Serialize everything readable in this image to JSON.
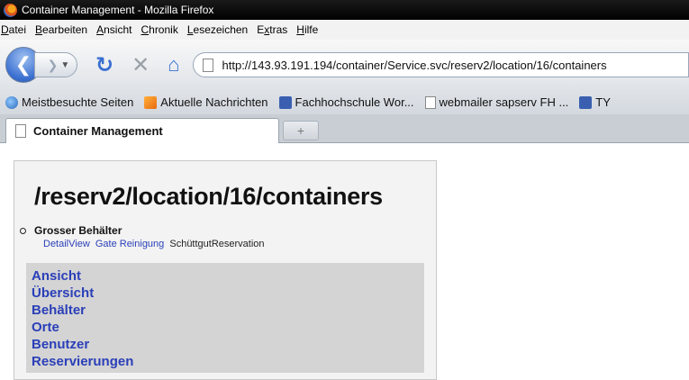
{
  "window": {
    "title": "Container Management - Mozilla Firefox"
  },
  "menu": {
    "items": [
      {
        "accel": "D",
        "rest": "atei"
      },
      {
        "accel": "B",
        "rest": "earbeiten"
      },
      {
        "accel": "A",
        "rest": "nsicht"
      },
      {
        "accel": "C",
        "rest": "hronik"
      },
      {
        "accel": "L",
        "rest": "esezeichen"
      },
      {
        "pre": "E",
        "accel": "x",
        "rest": "tras"
      },
      {
        "accel": "H",
        "rest": "ilfe"
      }
    ]
  },
  "navbar": {
    "url": "http://143.93.191.194/container/Service.svc/reserv2/location/16/containers"
  },
  "bookmarks": {
    "items": [
      {
        "label": "Meistbesuchte Seiten",
        "icon": "globe"
      },
      {
        "label": "Aktuelle Nachrichten",
        "icon": "rss"
      },
      {
        "label": "Fachhochschule Wor...",
        "icon": "hs"
      },
      {
        "label": "webmailer sapserv FH ...",
        "icon": "page"
      },
      {
        "label": "TY",
        "icon": "hs"
      }
    ]
  },
  "tabs": {
    "active_label": "Container Management",
    "new_tab_symbol": "+"
  },
  "page": {
    "title": "/reserv2/location/16/containers",
    "container": {
      "name": "Grosser Behälter",
      "links": [
        "DetailView",
        "Gate Reinigung"
      ],
      "plain_action": "SchüttgutReservation"
    },
    "nav_items": [
      "Ansicht",
      "Übersicht",
      "Behälter",
      "Orte",
      "Benutzer",
      "Reservierungen"
    ]
  }
}
